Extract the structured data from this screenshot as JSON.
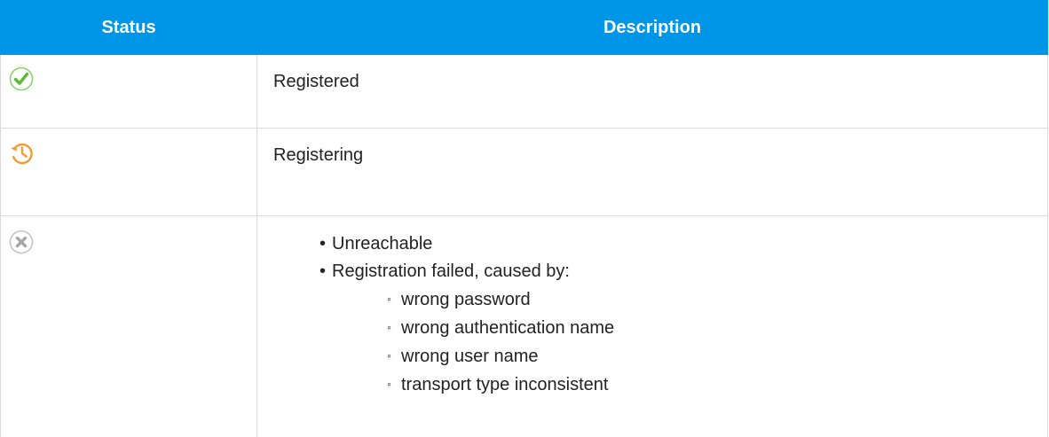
{
  "table": {
    "headers": {
      "status": "Status",
      "description": "Description"
    },
    "rows": [
      {
        "icon": "registered-check-icon",
        "icon_color": "#6cbb4f",
        "description": "Registered"
      },
      {
        "icon": "registering-history-icon",
        "icon_color": "#f39a31",
        "description": "Registering"
      },
      {
        "icon": "failed-x-icon",
        "icon_color": "#b8b8b8",
        "items": [
          {
            "bullet": "•",
            "label": "Unreachable"
          },
          {
            "bullet": "•",
            "label": "Registration failed, caused by:"
          }
        ],
        "sub_items": [
          {
            "bullet": "◦",
            "label": "wrong password"
          },
          {
            "bullet": "◦",
            "label": "wrong authentication name"
          },
          {
            "bullet": "◦",
            "label": "wrong user name"
          },
          {
            "bullet": "◦",
            "label": "transport type inconsistent"
          }
        ]
      }
    ]
  },
  "colors": {
    "header_background": "#0096e8",
    "header_text": "#ffffff",
    "border": "#d9d9d9",
    "body_text": "#222222"
  }
}
